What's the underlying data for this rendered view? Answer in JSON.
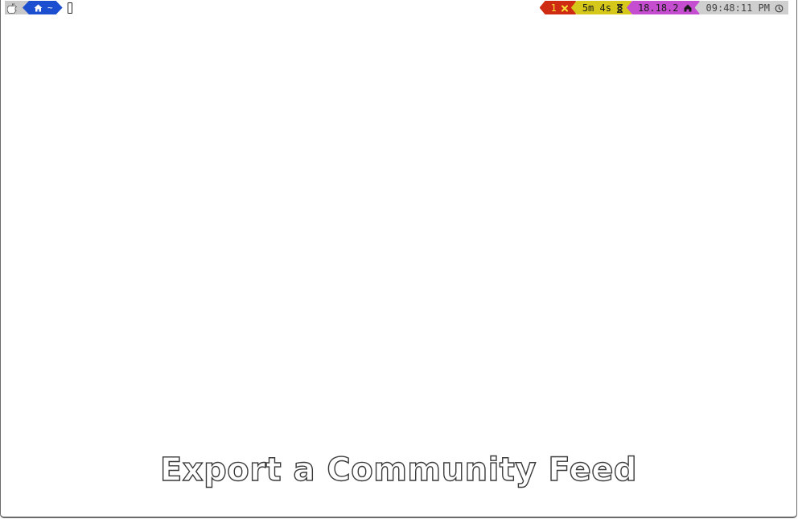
{
  "prompt": {
    "left": {
      "os_icon": "apple-icon",
      "dir_icon": "home-icon",
      "dir": "~"
    },
    "right": {
      "status_count": "1",
      "status_icon": "cross-icon",
      "duration": "5m 4s",
      "duration_icon": "hourglass-icon",
      "node_version": "18.18.2",
      "node_icon": "node-icon",
      "time": "09:48:11 PM",
      "clock_icon": "clock-icon"
    }
  },
  "title": "Export a Community Feed",
  "colors": {
    "dir_segment": "#1c4fd0",
    "status_segment": "#cf2a12",
    "duration_segment": "#d5c81a",
    "node_segment": "#c44ecf",
    "clock_segment": "#cfcfcf"
  }
}
